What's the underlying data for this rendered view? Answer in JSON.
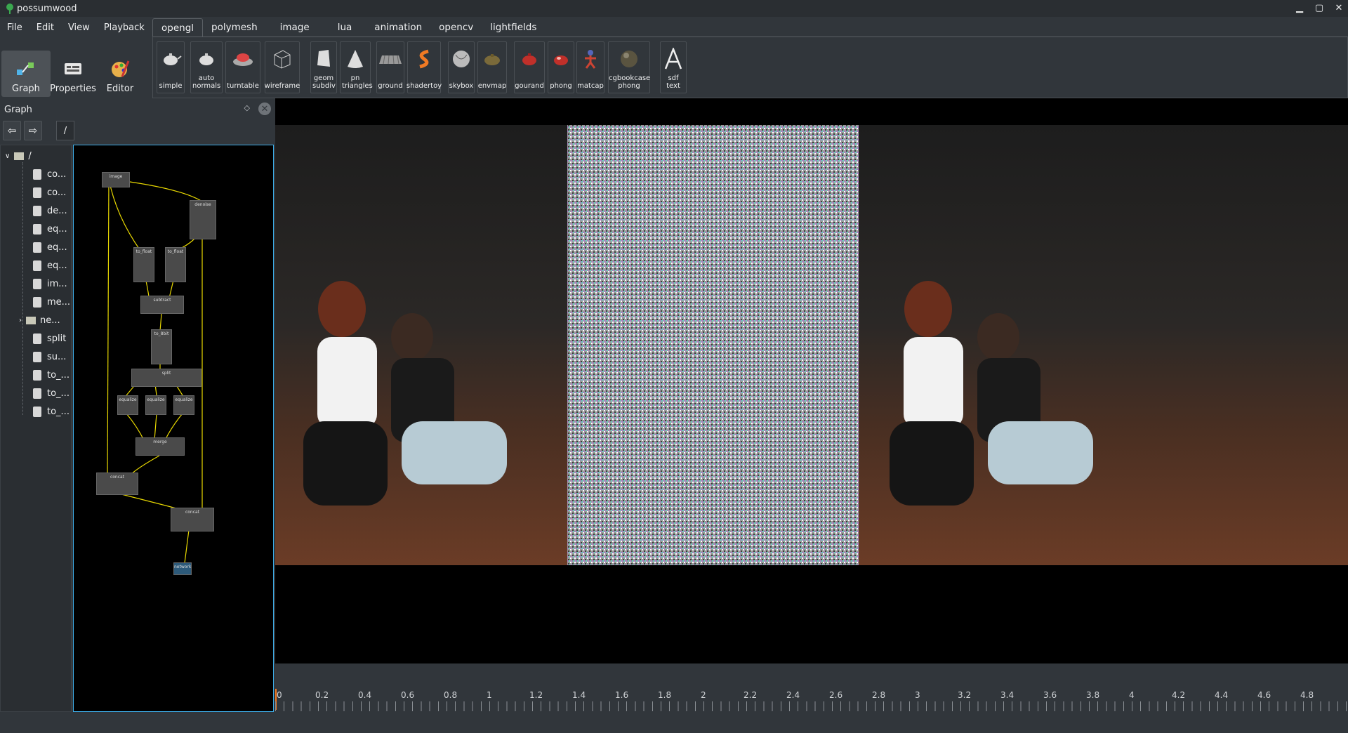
{
  "window": {
    "title": "possumwood",
    "min": "▁",
    "max": "▢",
    "close": "✕"
  },
  "menu": [
    {
      "label": "File"
    },
    {
      "label": "Edit"
    },
    {
      "label": "View"
    },
    {
      "label": "Playback"
    }
  ],
  "modes": [
    {
      "label": "Graph",
      "icon": "graph-icon"
    },
    {
      "label": "Properties",
      "icon": "properties-icon"
    },
    {
      "label": "Editor",
      "icon": "editor-icon"
    }
  ],
  "tabs": [
    {
      "label": "opengl"
    },
    {
      "label": "polymesh"
    },
    {
      "label": "image"
    },
    {
      "label": "lua"
    },
    {
      "label": "animation"
    },
    {
      "label": "opencv"
    },
    {
      "label": "lightfields"
    }
  ],
  "tools": [
    {
      "label": "simple",
      "icon": "teapot-icon"
    },
    {
      "label": "auto normals",
      "icon": "teapot-icon"
    },
    {
      "label": "turntable",
      "icon": "turntable-icon"
    },
    {
      "label": "wireframe",
      "icon": "wireframe-icon"
    },
    {
      "label": "geom subdiv",
      "icon": "geom-subdiv-icon"
    },
    {
      "label": "pn triangles",
      "icon": "cone-icon"
    },
    {
      "label": "ground",
      "icon": "ground-icon"
    },
    {
      "label": "shadertoy",
      "icon": "shadertoy-icon"
    },
    {
      "label": "skybox",
      "icon": "skybox-icon"
    },
    {
      "label": "envmap",
      "icon": "envmap-icon"
    },
    {
      "label": "gourand",
      "icon": "teapot-red-icon"
    },
    {
      "label": "phong",
      "icon": "teapot-red-icon"
    },
    {
      "label": "matcap",
      "icon": "matcap-icon"
    },
    {
      "label": "cgbookcase phong",
      "icon": "sphere-icon"
    },
    {
      "label": "sdf text",
      "icon": "sdf-text-icon"
    }
  ],
  "dock": {
    "title": "Graph",
    "float": "◇",
    "close": "✕",
    "path": "/"
  },
  "nav": {
    "back": "⇦",
    "forward": "⇨"
  },
  "tree": {
    "root": "/",
    "items": [
      {
        "label": "co..."
      },
      {
        "label": "co..."
      },
      {
        "label": "de..."
      },
      {
        "label": "eq..."
      },
      {
        "label": "eq..."
      },
      {
        "label": "eq..."
      },
      {
        "label": "im..."
      },
      {
        "label": "me..."
      },
      {
        "label": "ne..."
      },
      {
        "label": "split"
      },
      {
        "label": "su..."
      },
      {
        "label": "to_..."
      },
      {
        "label": "to_..."
      },
      {
        "label": "to_..."
      }
    ]
  },
  "graph_nodes": [
    {
      "label": "image"
    },
    {
      "label": "denoise"
    },
    {
      "label": "to_float"
    },
    {
      "label": "to_float"
    },
    {
      "label": "subtract"
    },
    {
      "label": "to_8bit"
    },
    {
      "label": "split"
    },
    {
      "label": "equalize"
    },
    {
      "label": "equalize"
    },
    {
      "label": "equalize"
    },
    {
      "label": "merge"
    },
    {
      "label": "concat"
    },
    {
      "label": "concat"
    },
    {
      "label": "network"
    }
  ],
  "timeline": {
    "ticks": [
      "0",
      "0.2",
      "0.4",
      "0.6",
      "0.8",
      "1",
      "1.2",
      "1.4",
      "1.6",
      "1.8",
      "2",
      "2.2",
      "2.4",
      "2.6",
      "2.8",
      "3",
      "3.2",
      "3.4",
      "3.6",
      "3.8",
      "4",
      "4.2",
      "4.4",
      "4.6",
      "4.8"
    ]
  },
  "colors": {
    "accent": "#3daee9",
    "wire": "#e8d800",
    "bg": "#31363b"
  }
}
